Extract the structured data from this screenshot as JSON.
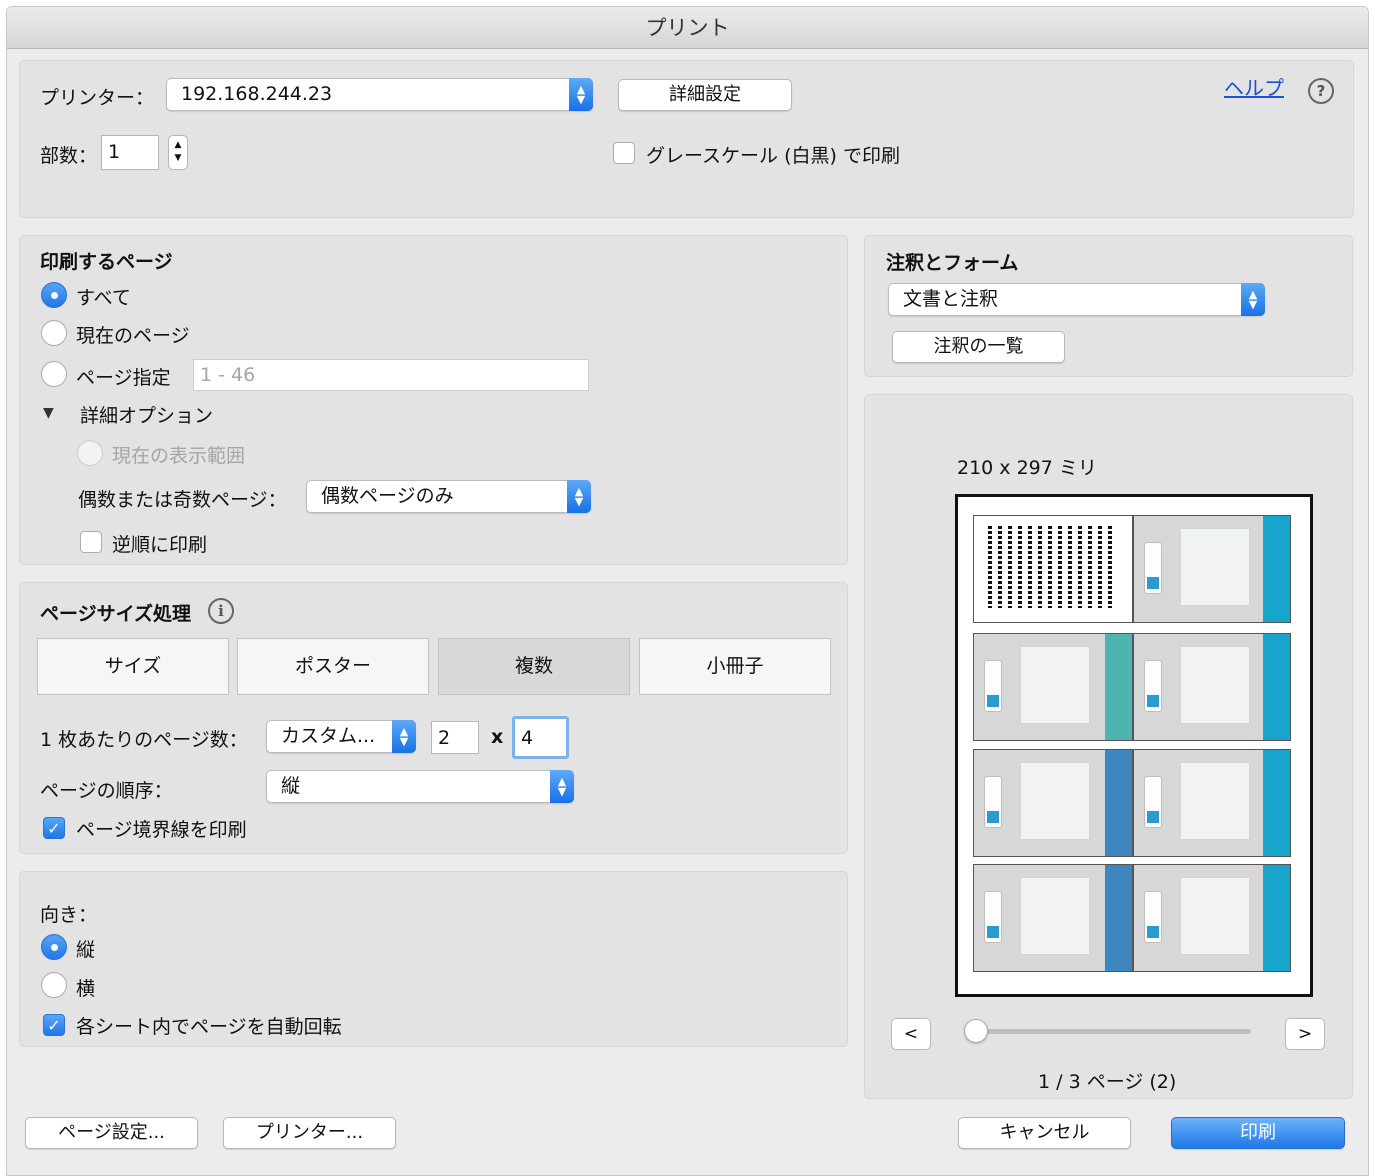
{
  "window": {
    "title": "プリント"
  },
  "printer": {
    "label": "プリンター：",
    "value": "192.168.244.23",
    "advanced_button": "詳細設定"
  },
  "help": {
    "link": "ヘルプ",
    "icon": "?"
  },
  "copies": {
    "label": "部数：",
    "value": "1"
  },
  "grayscale": {
    "label": "グレースケール (白黒) で印刷",
    "checked": false
  },
  "pages": {
    "heading": "印刷するページ",
    "all": "すべて",
    "current": "現在のページ",
    "range_label": "ページ指定",
    "range_placeholder": "1 - 46",
    "more_options": "詳細オプション",
    "current_view": "現在の表示範囲",
    "odd_even_label": "偶数または奇数ページ：",
    "odd_even_value": "偶数ページのみ",
    "reverse": "逆順に印刷",
    "selected": "all"
  },
  "sizing": {
    "heading": "ページサイズ処理",
    "info_icon": "i",
    "tabs": [
      "サイズ",
      "ポスター",
      "複数",
      "小冊子"
    ],
    "selected_tab": "複数",
    "per_sheet_label": "1 枚あたりのページ数：",
    "per_sheet_value": "カスタム...",
    "cols": "2",
    "times": "x",
    "rows": "4",
    "order_label": "ページの順序：",
    "order_value": "縦",
    "print_border": "ページ境界線を印刷",
    "print_border_checked": true
  },
  "orientation": {
    "label": "向き：",
    "portrait": "縦",
    "landscape": "横",
    "selected": "portrait",
    "auto_rotate": "各シート内でページを自動回転",
    "auto_rotate_checked": true
  },
  "comments": {
    "heading": "注釈とフォーム",
    "value": "文書と注釈",
    "summarize_button": "注釈の一覧"
  },
  "preview": {
    "paper_size": "210 x 297 ミリ",
    "prev": "<",
    "next": ">",
    "page_indicator": "1 / 3 ページ (2)"
  },
  "footer": {
    "page_setup": "ページ設定...",
    "printer": "プリンター...",
    "cancel": "キャンセル",
    "print": "印刷"
  },
  "colors": {
    "accent": "#1e78e8",
    "stripe": "#17a5cc"
  }
}
